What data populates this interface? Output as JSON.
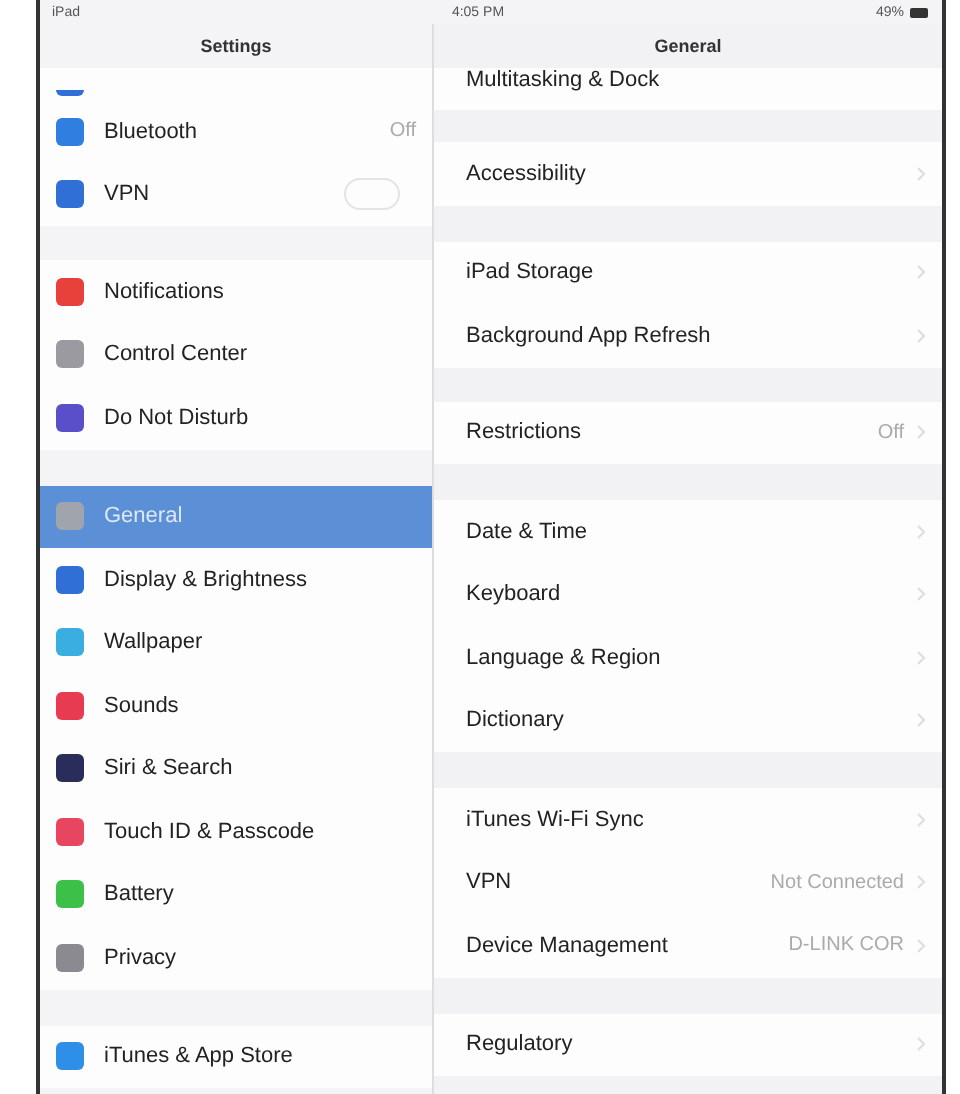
{
  "status_bar": {
    "device": "iPad",
    "time": "4:05 PM",
    "battery": "49%"
  },
  "sidebar": {
    "title": "Settings",
    "groups": [
      {
        "items": [
          {
            "kind": "partial",
            "color": "#2f6fd6"
          },
          {
            "kind": "link",
            "label": "Bluetooth",
            "value": "Off",
            "color": "#2f7ee0",
            "selected": false
          },
          {
            "kind": "toggle",
            "label": "VPN",
            "on": false,
            "color": "#2f6fd6",
            "selected": false
          }
        ]
      },
      {
        "items": [
          {
            "kind": "link",
            "label": "Notifications",
            "color": "#e8403a",
            "selected": false
          },
          {
            "kind": "link",
            "label": "Control Center",
            "color": "#9a9aa0",
            "selected": false
          },
          {
            "kind": "link",
            "label": "Do Not Disturb",
            "color": "#5a4fc8",
            "selected": false
          }
        ]
      },
      {
        "items": [
          {
            "kind": "link",
            "label": "General",
            "color": "#a0a4ac",
            "selected": true
          },
          {
            "kind": "link",
            "label": "Display & Brightness",
            "color": "#2f6fd6",
            "selected": false
          },
          {
            "kind": "link",
            "label": "Wallpaper",
            "color": "#3aaee0",
            "selected": false
          },
          {
            "kind": "link",
            "label": "Sounds",
            "color": "#e83a50",
            "selected": false
          },
          {
            "kind": "link",
            "label": "Siri & Search",
            "color": "#2a2d5a",
            "selected": false
          },
          {
            "kind": "link",
            "label": "Touch ID & Passcode",
            "color": "#e84660",
            "selected": false
          },
          {
            "kind": "link",
            "label": "Battery",
            "color": "#3cc048",
            "selected": false
          },
          {
            "kind": "link",
            "label": "Privacy",
            "color": "#8a8a90",
            "selected": false
          }
        ]
      },
      {
        "items": [
          {
            "kind": "link",
            "label": "iTunes & App Store",
            "color": "#2f8ee8",
            "selected": false
          }
        ]
      }
    ]
  },
  "detail": {
    "title": "General",
    "groups": [
      {
        "rows": [
          {
            "label": "Multitasking & Dock"
          }
        ]
      },
      {
        "rows": [
          {
            "label": "Accessibility"
          }
        ]
      },
      {
        "rows": [
          {
            "label": "iPad Storage"
          },
          {
            "label": "Background App Refresh"
          }
        ]
      },
      {
        "rows": [
          {
            "label": "Restrictions",
            "value": "Off"
          }
        ]
      },
      {
        "rows": [
          {
            "label": "Date & Time"
          },
          {
            "label": "Keyboard"
          },
          {
            "label": "Language & Region"
          },
          {
            "label": "Dictionary"
          }
        ]
      },
      {
        "rows": [
          {
            "label": "iTunes Wi-Fi Sync"
          },
          {
            "label": "VPN",
            "value": "Not Connected"
          },
          {
            "label": "Device Management",
            "value": "D-LINK COR"
          }
        ]
      },
      {
        "rows": [
          {
            "label": "Regulatory"
          }
        ]
      }
    ]
  }
}
